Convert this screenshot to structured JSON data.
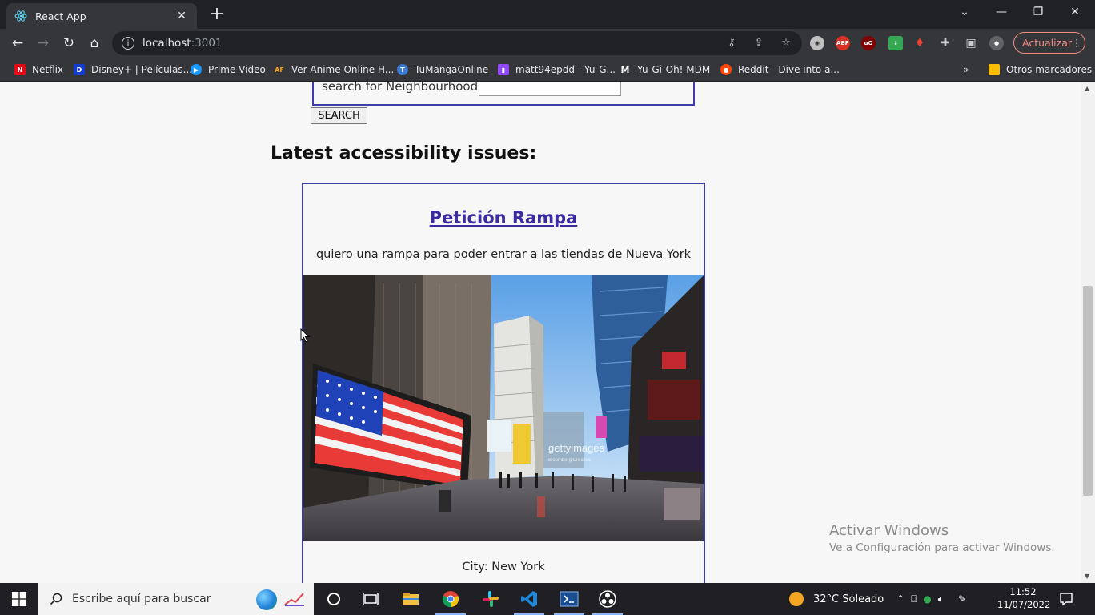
{
  "browser": {
    "tab_title": "React App",
    "url_host": "localhost",
    "url_port": ":3001",
    "update_label": "Actualizar",
    "bookmarks": [
      {
        "label": "Netflix"
      },
      {
        "label": "Disney+ | Películas..."
      },
      {
        "label": "Prime Video"
      },
      {
        "label": "Ver Anime Online H..."
      },
      {
        "label": "TuMangaOnline"
      },
      {
        "label": "matt94epdd - Yu-G..."
      },
      {
        "label": "Yu-Gi-Oh! MDM"
      },
      {
        "label": "Reddit - Dive into a..."
      }
    ],
    "other_bookmarks": "Otros marcadores",
    "overflow": "»"
  },
  "page": {
    "search_label": "search for Neighbourhood:",
    "search_value": "",
    "search_button": "SEARCH",
    "section_title": "Latest accessibility issues:",
    "issue": {
      "title": "Petición Rampa",
      "description": "quiero una rampa para poder entrar a las tiendas de Nueva York",
      "image_watermark": "gettyimages",
      "image_credit": "Bloomberg Creative",
      "city": "City: New York"
    }
  },
  "watermark": {
    "line1": "Activar Windows",
    "line2": "Ve a Configuración para activar Windows."
  },
  "taskbar": {
    "search_placeholder": "Escribe aquí para buscar",
    "weather": "32°C  Soleado",
    "time": "11:52",
    "date": "11/07/2022"
  },
  "colors": {
    "accent": "#3d3daa",
    "link": "#3a2ba0",
    "chrome_dark": "#202124",
    "chrome_toolbar": "#35363a",
    "update_red": "#f28b82"
  }
}
